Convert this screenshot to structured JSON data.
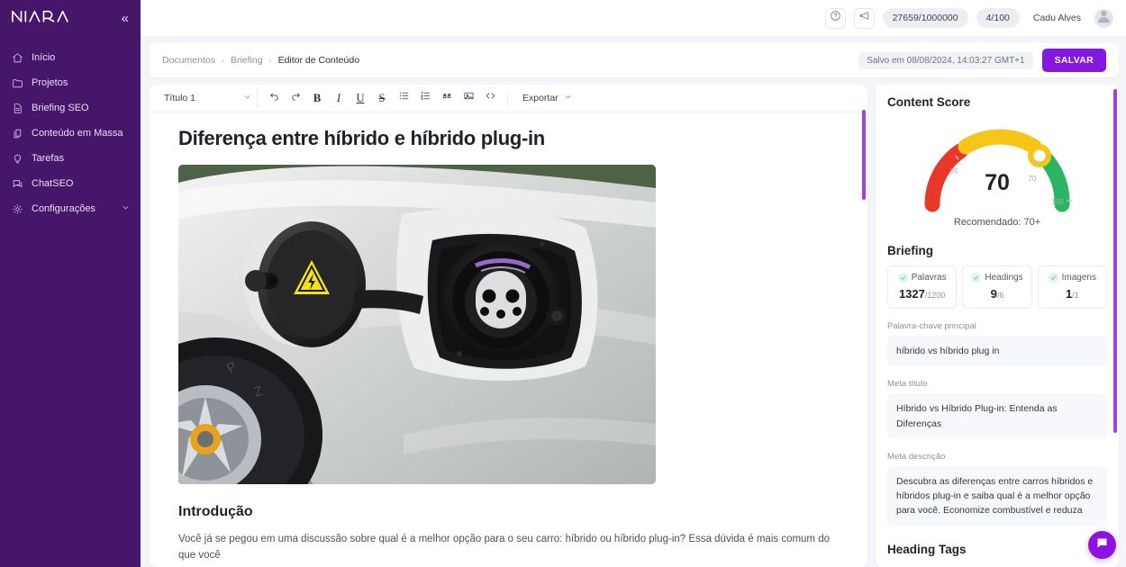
{
  "brand": {
    "name": "NIARA",
    "collapse_icon": "chevron-double-left-icon",
    "sidebar_color": "#46166b"
  },
  "sidebar": {
    "items": [
      {
        "label": "Início",
        "icon": "home-icon"
      },
      {
        "label": "Projetos",
        "icon": "folder-icon"
      },
      {
        "label": "Briefing SEO",
        "icon": "document-icon"
      },
      {
        "label": "Conteúdo em Massa",
        "icon": "layers-copy-icon"
      },
      {
        "label": "Tarefas",
        "icon": "lightbulb-icon"
      },
      {
        "label": "ChatSEO",
        "icon": "chat-icon"
      },
      {
        "label": "Configurações",
        "icon": "gear-icon",
        "chevron": true
      }
    ]
  },
  "topbar": {
    "help_icon": "question-circle-icon",
    "announce_icon": "megaphone-icon",
    "credits": "27659/1000000",
    "quota": "4/100",
    "user_name": "Cadu Alves",
    "avatar_icon": "user-avatar-icon"
  },
  "breadcrumb": {
    "items": [
      "Documentos",
      "Briefing"
    ],
    "current": "Editor de Conteúdo",
    "separator": "›"
  },
  "save": {
    "status": "Salvo em 08/08/2024, 14:03:27 GMT+1",
    "button": "SALVAR",
    "button_color": "#8417e0"
  },
  "toolbar": {
    "style_select": "Título 1",
    "buttons": [
      {
        "name": "undo-icon",
        "glyph": "undo"
      },
      {
        "name": "redo-icon",
        "glyph": "redo"
      },
      {
        "name": "bold-icon",
        "glyph": "B"
      },
      {
        "name": "italic-icon",
        "glyph": "I"
      },
      {
        "name": "underline-icon",
        "glyph": "U"
      },
      {
        "name": "strikethrough-icon",
        "glyph": "S"
      },
      {
        "name": "bullet-list-icon",
        "glyph": "ul"
      },
      {
        "name": "numbered-list-icon",
        "glyph": "ol"
      },
      {
        "name": "quote-icon",
        "glyph": "quote"
      },
      {
        "name": "image-icon",
        "glyph": "image"
      },
      {
        "name": "code-icon",
        "glyph": "code"
      }
    ],
    "export_label": "Exportar"
  },
  "document": {
    "title": "Diferença entre híbrido e híbrido plug-in",
    "image_alt": "Porta de carregamento de carro elétrico híbrido plug-in prateado",
    "section_heading": "Introdução",
    "paragraph": "Você já se pegou em uma discussão sobre qual é a melhor opção para o seu carro: híbrido ou híbrido plug-in? Essa dúvida é mais comum do que você"
  },
  "panel": {
    "content_score_title": "Content Score",
    "briefing_title": "Briefing",
    "heading_tags_title": "Heading Tags",
    "recommendation": "Recomendado: 70+",
    "stats": [
      {
        "label": "Palavras",
        "value": "1327",
        "denominator": "/1200",
        "ok": true
      },
      {
        "label": "Headings",
        "value": "9",
        "denominator": "/6",
        "ok": true
      },
      {
        "label": "Imagens",
        "value": "1",
        "denominator": "/1",
        "ok": true
      }
    ],
    "fields": [
      {
        "label": "Palavra-chave principal",
        "value": "híbrido vs híbrido plug in"
      },
      {
        "label": "Meta título",
        "value": "Híbrido vs Híbrido Plug-in: Entenda as Diferenças"
      },
      {
        "label": "Meta descrição",
        "value": "Descubra as diferenças entre carros híbridos e híbridos plug-in e saiba qual é a melhor opção para você. Economize combustível e reduza"
      }
    ]
  },
  "chart_data": {
    "type": "gauge",
    "title": "Content Score",
    "value": 70,
    "min": 0,
    "max": 100,
    "tick_labels": [
      "35",
      "70",
      "100"
    ],
    "ticks": [
      35,
      70,
      100
    ],
    "bands": [
      {
        "name": "low",
        "from": 0,
        "to": 35,
        "color": "#e8382a"
      },
      {
        "name": "medium",
        "from": 35,
        "to": 70,
        "color": "#f5c518"
      },
      {
        "name": "high",
        "from": 70,
        "to": 100,
        "color": "#2bb563"
      }
    ],
    "needle_color": "#f5c518",
    "annotation": "Recomendado: 70+"
  },
  "chat_fab": {
    "icon": "chat-bubble-icon",
    "color": "#9012e0"
  }
}
